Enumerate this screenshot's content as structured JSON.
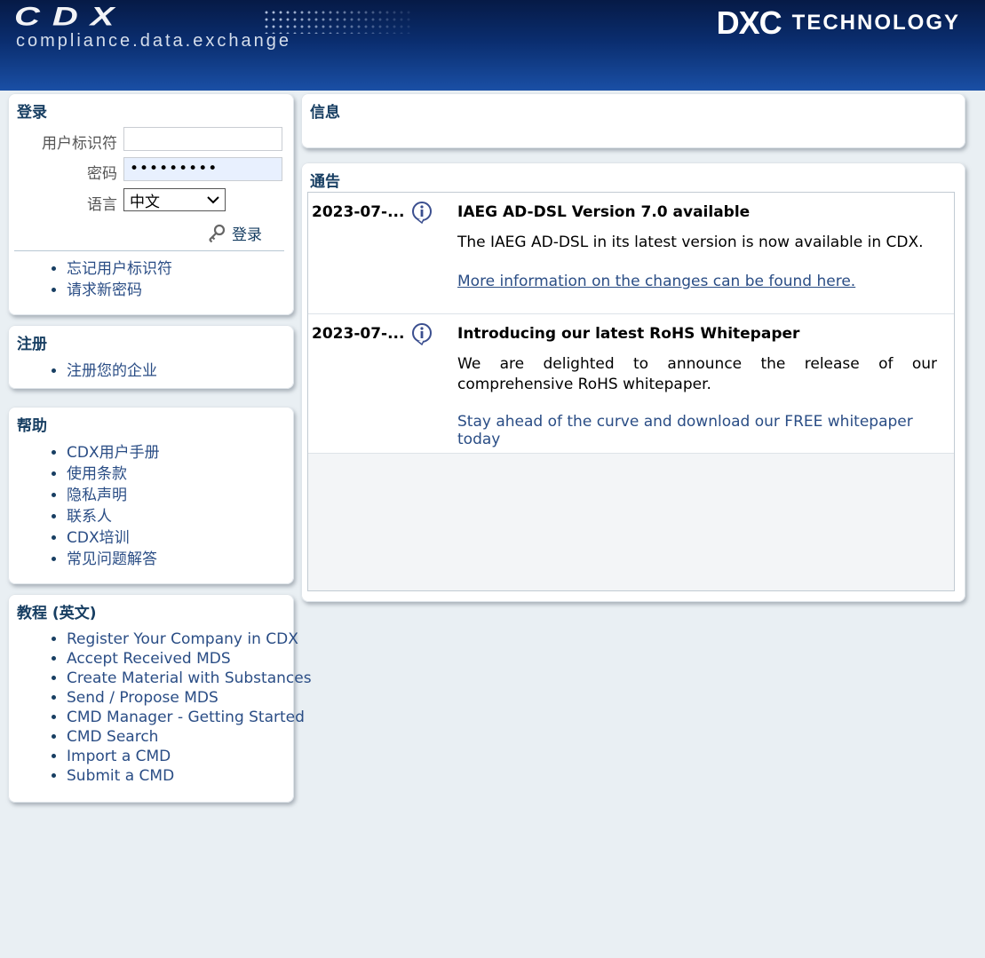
{
  "header": {
    "cdx_logo": "CDX",
    "cdx_tagline": "compliance.data.exchange",
    "dxc_mark": "DXC",
    "dxc_text": "TECHNOLOGY"
  },
  "login": {
    "title": "登录",
    "user_label": "用户标识符",
    "user_value": "",
    "password_label": "密码",
    "password_value": "•••••••••",
    "language_label": "语言",
    "language_selected": "中文",
    "login_button": "登录",
    "links": [
      "忘记用户标识符",
      "请求新密码"
    ]
  },
  "register": {
    "title": "注册",
    "links": [
      "注册您的企业"
    ]
  },
  "help": {
    "title": "帮助",
    "links": [
      "CDX用户手册",
      "使用条款",
      "隐私声明",
      "联系人",
      "CDX培训",
      "常见问题解答"
    ]
  },
  "tutorials": {
    "title": "教程 (英文)",
    "links": [
      "Register Your Company in CDX",
      "Accept Received MDS",
      "Create Material with Substances",
      "Send / Propose MDS",
      "CMD Manager - Getting Started",
      "CMD Search",
      "Import a CMD",
      "Submit a CMD"
    ]
  },
  "info": {
    "title": "信息"
  },
  "announcements": {
    "title": "通告",
    "items": [
      {
        "date": "2023-07-...",
        "title": "IAEG AD-DSL Version 7.0 available",
        "body": "The IAEG AD-DSL in its latest version is now available in CDX.",
        "link": "More information on the changes can be found here."
      },
      {
        "date": "2023-07-...",
        "title": "Introducing our latest RoHS Whitepaper",
        "body": "We are delighted to announce the release of our comprehensive RoHS whitepaper.",
        "link": "Stay ahead of the curve and download our FREE whitepaper today"
      }
    ]
  },
  "colors": {
    "header_dark": "#061a46",
    "header_light": "#1a4fa5",
    "link": "#2a4d85",
    "heading": "#173e62",
    "page_bg": "#e9eff3"
  }
}
